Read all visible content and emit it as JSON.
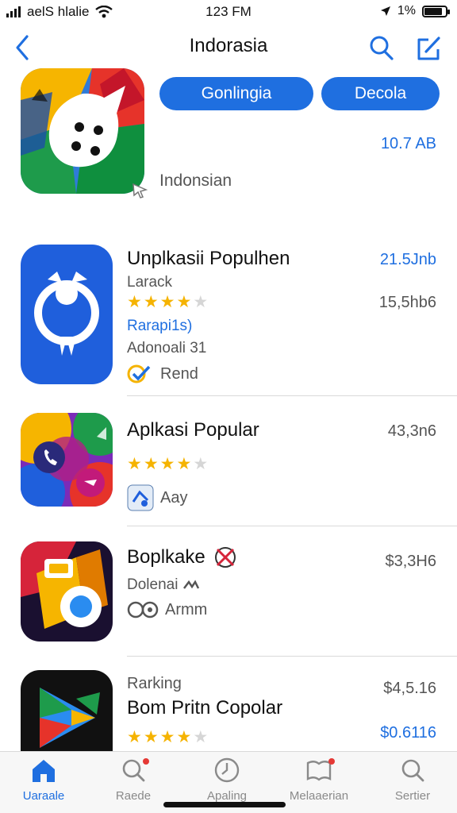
{
  "status": {
    "carrier": "aelS hlalie",
    "time": "123 FM",
    "battery": "1%",
    "battery_level": 0.85
  },
  "nav": {
    "title": "Indorasia"
  },
  "hero": {
    "buttons": [
      "Gonlingia",
      "Decola"
    ],
    "size": "10.7 AB",
    "label": "Indonsian"
  },
  "apps": [
    {
      "name": "Unplkasii Populhen",
      "subtitle": "Larack",
      "price": "21.5Jnb",
      "price2": "15,5hb6",
      "rating": 4,
      "link": "Rarapi1s)",
      "extra": "Adonoali 31",
      "chip": "Rend"
    },
    {
      "name": "Aplkasi Popular",
      "price": "43,3n6",
      "rating": 4,
      "chip": "Aay"
    },
    {
      "name": "Boplkake",
      "subtitle": "Dolenai",
      "price": "$3,3H6",
      "chip": "Armm"
    },
    {
      "name": "Bom Pritn Copolar",
      "kicker": "Rarking",
      "price": "$4,5.16",
      "price2": "$0.6116",
      "rating": 4
    }
  ],
  "tabs": [
    "Uaraale",
    "Raede",
    "Apaling",
    "Melaaerian",
    "Sertier"
  ],
  "colors": {
    "accent": "#1f6fe0",
    "star": "#f5b301"
  }
}
